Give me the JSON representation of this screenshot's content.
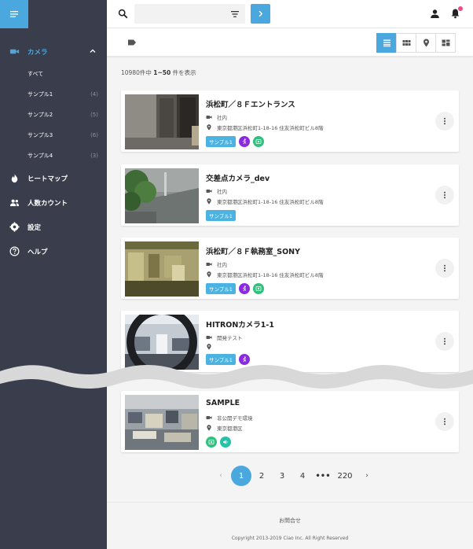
{
  "sidebar": {
    "items": [
      {
        "label": "カメラ",
        "icon": "video-camera-icon",
        "active": true
      },
      {
        "label": "ヒートマップ",
        "icon": "flame-icon"
      },
      {
        "label": "人数カウント",
        "icon": "people-icon"
      },
      {
        "label": "設定",
        "icon": "gear-icon"
      },
      {
        "label": "ヘルプ",
        "icon": "help-icon"
      }
    ],
    "sub_items": [
      {
        "label": "すべて",
        "count": ""
      },
      {
        "label": "サンプル1",
        "count": "(4)"
      },
      {
        "label": "サンプル2",
        "count": "(5)"
      },
      {
        "label": "サンプル3",
        "count": "(6)"
      },
      {
        "label": "サンプル4",
        "count": "(3)"
      }
    ]
  },
  "search": {
    "value": "",
    "placeholder": ""
  },
  "results": {
    "total": "10980件中",
    "range": "1~50",
    "suffix": "件を表示"
  },
  "cameras": [
    {
      "title": "浜松町／８Ｆエントランス",
      "category": "社内",
      "address": "東京都港区浜松町1-18-16 住友浜松町ビル8階",
      "tag": "サンプル1"
    },
    {
      "title": "交差点カメラ_dev",
      "category": "社内",
      "address": "東京都港区浜松町1-18-16 住友浜松町ビル8階",
      "tag": "サンプル1"
    },
    {
      "title": "浜松町／８Ｆ執務室_SONY",
      "category": "社内",
      "address": "東京都港区浜松町1-18-16 住友浜松町ビル8階",
      "tag": "サンプル1"
    },
    {
      "title": "HITRONカメラ1-1",
      "category": "開発テスト",
      "address": "",
      "tag": "サンプル1"
    },
    {
      "title": "SAMPLE",
      "category": "非公開デモ環境",
      "address": "東京都港区",
      "tag": ""
    }
  ],
  "pagination": {
    "prev": "‹",
    "pages": [
      "1",
      "2",
      "3",
      "4"
    ],
    "ellipsis": "•••",
    "last": "220",
    "next": "›"
  },
  "footer": {
    "contact": "お問合せ",
    "copyright": "Copyright 2013-2019 Ciao Inc. All Right Reserved"
  },
  "colors": {
    "sidebar": "#3a3d4b",
    "accent": "#4aa8df",
    "tag": "#4ab3e2",
    "purple": "#8a2be2",
    "green": "#2ec27e",
    "teal": "#22c3a6",
    "notify": "#e94e8a"
  }
}
